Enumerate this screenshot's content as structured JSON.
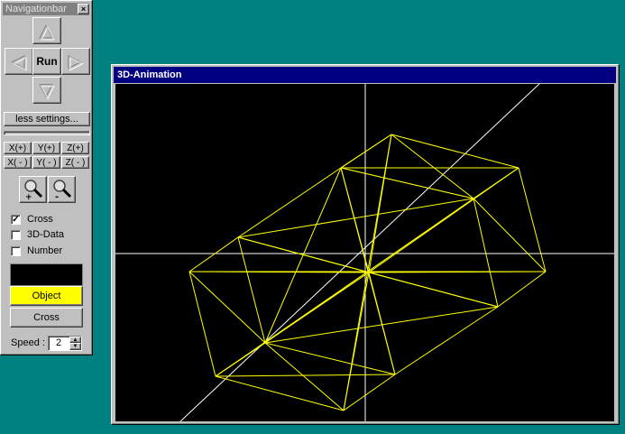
{
  "navbar": {
    "title": "Navigationbar",
    "close_icon": "×",
    "run_label": "Run",
    "up_icon": "△",
    "down_icon": "▽",
    "left_icon": "◁",
    "right_icon": "▷",
    "settings_label": "less settings...",
    "axis_buttons": [
      "X(+)",
      "Y(+)",
      "Z(+)",
      "X( - )",
      "Y( - )",
      "Z( - )"
    ],
    "zoom_in_icon": "zoom-in-icon",
    "zoom_out_icon": "zoom-out-icon",
    "checkboxes": [
      {
        "label": "Cross",
        "checked": true
      },
      {
        "label": "3D-Data",
        "checked": false
      },
      {
        "label": "Number",
        "checked": false
      }
    ],
    "color_swatch": "#000000",
    "object_label": "Object",
    "object_color": "#ffff00",
    "cross_label": "Cross",
    "speed_label": "Speed :",
    "speed_value": "2"
  },
  "animation_window": {
    "title": "3D-Animation",
    "wire_color": "#ffff00",
    "cross_color": "#ffffff"
  }
}
